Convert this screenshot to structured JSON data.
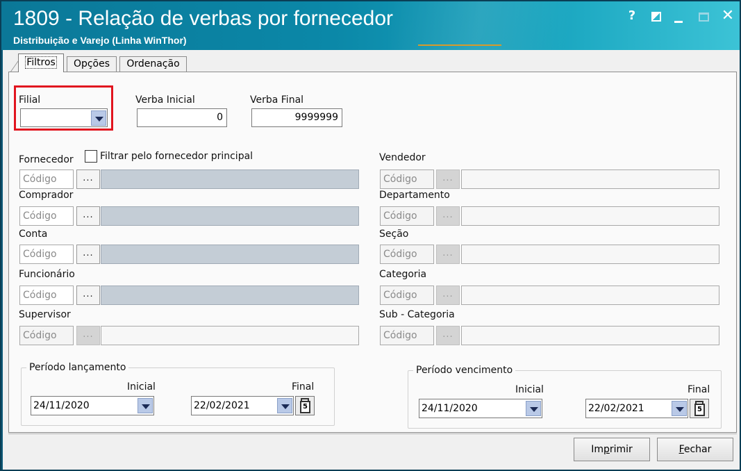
{
  "window": {
    "title": "1809 - Relação de verbas por fornecedor",
    "subtitle": "Distribuição e Varejo (Linha WinThor)",
    "controls": {
      "help": "?",
      "close": "✕"
    }
  },
  "tabs": [
    {
      "label": "Filtros",
      "active": true
    },
    {
      "label": "Opções",
      "active": false
    },
    {
      "label": "Ordenação",
      "active": false
    }
  ],
  "top_fields": {
    "filial_label": "Filial",
    "filial_value": "",
    "verba_inicial_label": "Verba Inicial",
    "verba_inicial_value": "0",
    "verba_final_label": "Verba Final",
    "verba_final_value": "9999999"
  },
  "filters_left": {
    "fornecedor_label": "Fornecedor",
    "fornecedor_principal_label": "Filtrar pelo fornecedor principal",
    "fornecedor_principal_checked": false,
    "comprador_label": "Comprador",
    "conta_label": "Conta",
    "funcionario_label": "Funcionário",
    "supervisor_label": "Supervisor"
  },
  "filters_right": {
    "vendedor_label": "Vendedor",
    "departamento_label": "Departamento",
    "secao_label": "Seção",
    "categoria_label": "Categoria",
    "subcategoria_label": "Sub - Categoria"
  },
  "lookup": {
    "code_placeholder": "Código",
    "browse_label": "..."
  },
  "periodo_lancamento": {
    "legend": "Período lançamento",
    "inicial_label": "Inicial",
    "inicial_value": "24/11/2020",
    "final_label": "Final",
    "final_value": "22/02/2021"
  },
  "periodo_vencimento": {
    "legend": "Período vencimento",
    "inicial_label": "Inicial",
    "inicial_value": "24/11/2020",
    "final_label": "Final",
    "final_value": "22/02/2021"
  },
  "calendar_icon_text": "5",
  "buttons": {
    "imprimir_pre": "Im",
    "imprimir_key": "p",
    "imprimir_post": "rimir",
    "fechar_key": "F",
    "fechar_post": "echar"
  },
  "colors": {
    "titlebar": "#0b88a8",
    "highlight": "#e1151f",
    "dropdown_button": "#b9c9e7"
  }
}
